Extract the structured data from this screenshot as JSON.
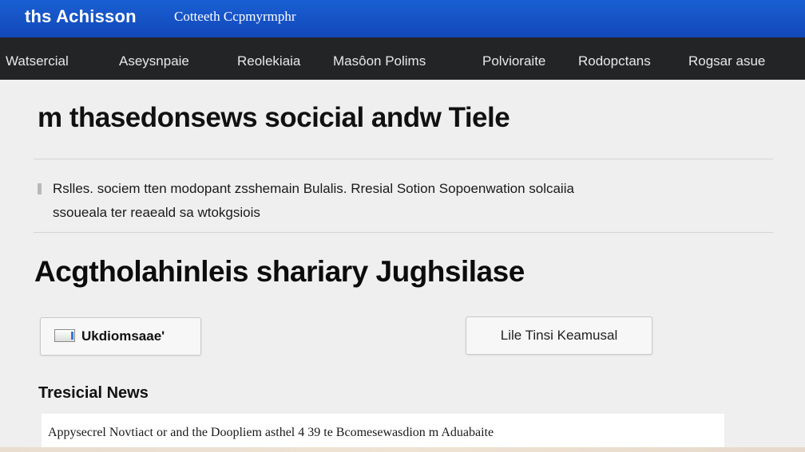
{
  "header": {
    "brand": "ths Achisson",
    "tagline": "Cotteeth Ccpmyrmphr",
    "background_color": "#1a5fd4"
  },
  "nav": {
    "items": [
      {
        "label": "Watsercial"
      },
      {
        "label": "Aseysnpaie"
      },
      {
        "label": "Reolekiaia"
      },
      {
        "label": "Masôon Polims"
      },
      {
        "label": "Polvioraite"
      },
      {
        "label": "Rodopctans"
      },
      {
        "label": "Rogsar asue"
      }
    ],
    "background_color": "#222426"
  },
  "main": {
    "title": "m thasedonsews socicial andw Tiele",
    "intro_lines": [
      "Rslles. sociem tten modopant  zsshemain Bulalis.  Rresial Sotion  Sopoenwation  solcaiia",
      "ssoueala ter reaeald  sa wtokgsiois"
    ],
    "section_heading": "Acgtholahinleis shariary Jughsilase",
    "buttons": {
      "left_label": "Ukdiomsaae'",
      "left_icon": "window-icon",
      "right_label": "Lile Tinsi Keamusal"
    },
    "news": {
      "heading": "Tresicial News",
      "items": [
        {
          "text": "Appysecrel Novtiact or and the Doopliem asthel 4 39 te Bcomesewasdion m Aduabaite"
        }
      ]
    }
  }
}
